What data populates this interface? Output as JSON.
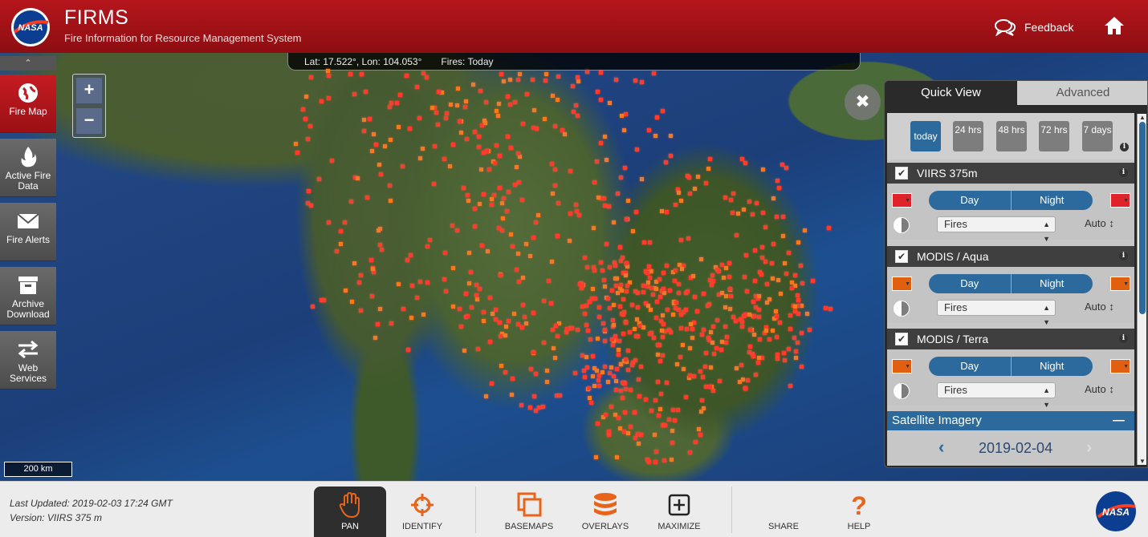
{
  "header": {
    "title": "FIRMS",
    "subtitle": "Fire Information for Resource Management System",
    "feedback_label": "Feedback"
  },
  "coords": {
    "latlon": "Lat: 17.522°, Lon: 104.053°",
    "fires": "Fires: Today"
  },
  "sidebar": {
    "collapse_icon": "chevron-up-icon",
    "items": [
      {
        "label": "Fire Map",
        "icon": "globe-icon"
      },
      {
        "label": "Active Fire Data",
        "icon": "flame-icon"
      },
      {
        "label": "Fire Alerts",
        "icon": "envelope-icon"
      },
      {
        "label": "Archive Download",
        "icon": "archive-box-icon"
      },
      {
        "label": "Web Services",
        "icon": "arrows-exchange-icon"
      }
    ]
  },
  "zoom": {
    "in": "+",
    "out": "−"
  },
  "scale_label": "200 km",
  "panel": {
    "tabs": [
      "Quick View",
      "Advanced"
    ],
    "time_filters": [
      "today",
      "24 hrs",
      "48 hrs",
      "72 hrs",
      "7 days"
    ],
    "selected_time": "today",
    "layers": [
      {
        "name": "VIIRS 375m",
        "day": "Day",
        "night": "Night",
        "display": "Fires",
        "opacity": "Auto",
        "color": "#e0232a"
      },
      {
        "name": "MODIS / Aqua",
        "day": "Day",
        "night": "Night",
        "display": "Fires",
        "opacity": "Auto",
        "color": "#e06010"
      },
      {
        "name": "MODIS / Terra",
        "day": "Day",
        "night": "Night",
        "display": "Fires",
        "opacity": "Auto",
        "color": "#e06010"
      }
    ],
    "satellite": {
      "title": "Satellite Imagery",
      "date": "2019-02-04"
    }
  },
  "footer": {
    "last_updated": "Last Updated: 2019-02-03 17:24 GMT",
    "version": "Version: VIIRS 375 m",
    "tools": [
      {
        "label": "PAN",
        "icon": "hand-icon",
        "active": true
      },
      {
        "label": "IDENTIFY",
        "icon": "crosshair-icon"
      },
      {
        "label": "BASEMAPS",
        "icon": "layers-copy-icon"
      },
      {
        "label": "OVERLAYS",
        "icon": "database-stack-icon"
      },
      {
        "label": "MAXIMIZE",
        "icon": "plus-square-icon"
      },
      {
        "label": "SHARE",
        "icon": "share-icon"
      },
      {
        "label": "HELP",
        "icon": "question-icon"
      }
    ]
  },
  "colors": {
    "brand_red": "#b5161b",
    "accent_blue": "#2c6a9e",
    "fire_red": "#ff3b2e",
    "tool_orange": "#e8641a"
  }
}
